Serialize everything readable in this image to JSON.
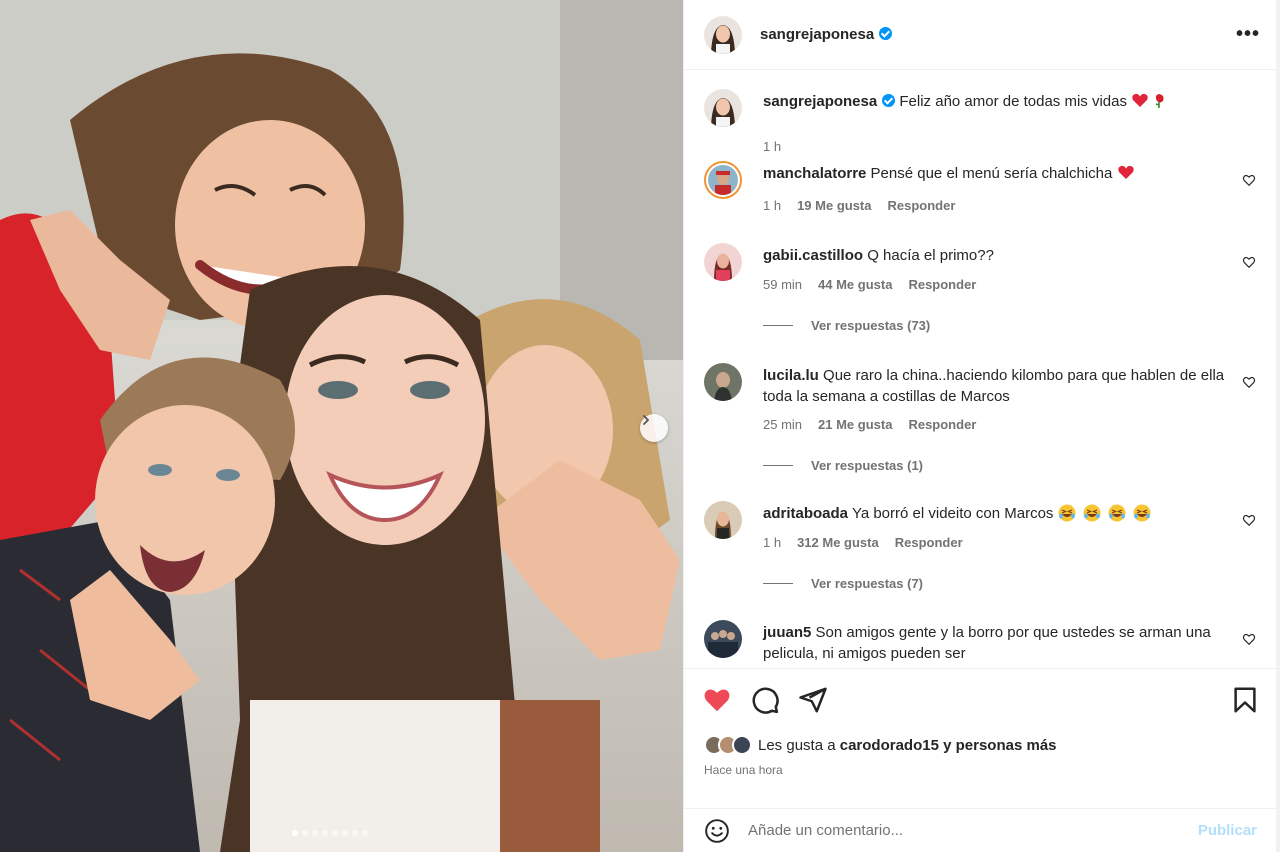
{
  "post": {
    "author": "sangrejaponesa",
    "caption": "Feliz año amor de todas mis vidas",
    "caption_time": "1 h",
    "more_icon": "more-horizontal-icon",
    "carousel_dots": 8
  },
  "comments": [
    {
      "user": "manchalatorre",
      "text": "Pensé que el menú sería chalchicha",
      "emoji": "❤️",
      "time": "1 h",
      "likes": "19 Me gusta",
      "reply": "Responder"
    },
    {
      "user": "gabii.castilloo",
      "text": "Q hacía el primo??",
      "time": "59 min",
      "likes": "44 Me gusta",
      "reply": "Responder",
      "view_replies": "Ver respuestas (73)"
    },
    {
      "user": "lucila.lu",
      "text": "Que raro la china..haciendo kilombo para que hablen de ella toda la semana a costillas de Marcos",
      "time": "25 min",
      "likes": "21 Me gusta",
      "reply": "Responder",
      "view_replies": "Ver respuestas (1)"
    },
    {
      "user": "adritaboada",
      "text": "Ya borró el videito con Marcos",
      "emoji": "😂😂😂😂",
      "time": "1 h",
      "likes": "312 Me gusta",
      "reply": "Responder",
      "view_replies": "Ver respuestas (7)"
    },
    {
      "user": "juuan5",
      "text": "Son amigos gente y la borro por que ustedes se arman una pelicula, ni amigos pueden ser"
    }
  ],
  "actions": {
    "liked_by_prefix": "Les gusta a",
    "liked_by_user": "carodorado15",
    "liked_by_suffix": "y personas más",
    "timestamp": "Hace una hora"
  },
  "add_comment": {
    "placeholder": "Añade un comentario...",
    "publish": "Publicar"
  },
  "colors": {
    "like_red": "#ed4956",
    "link_blue": "#0095f6",
    "publish_disabled": "#b2dffc"
  }
}
